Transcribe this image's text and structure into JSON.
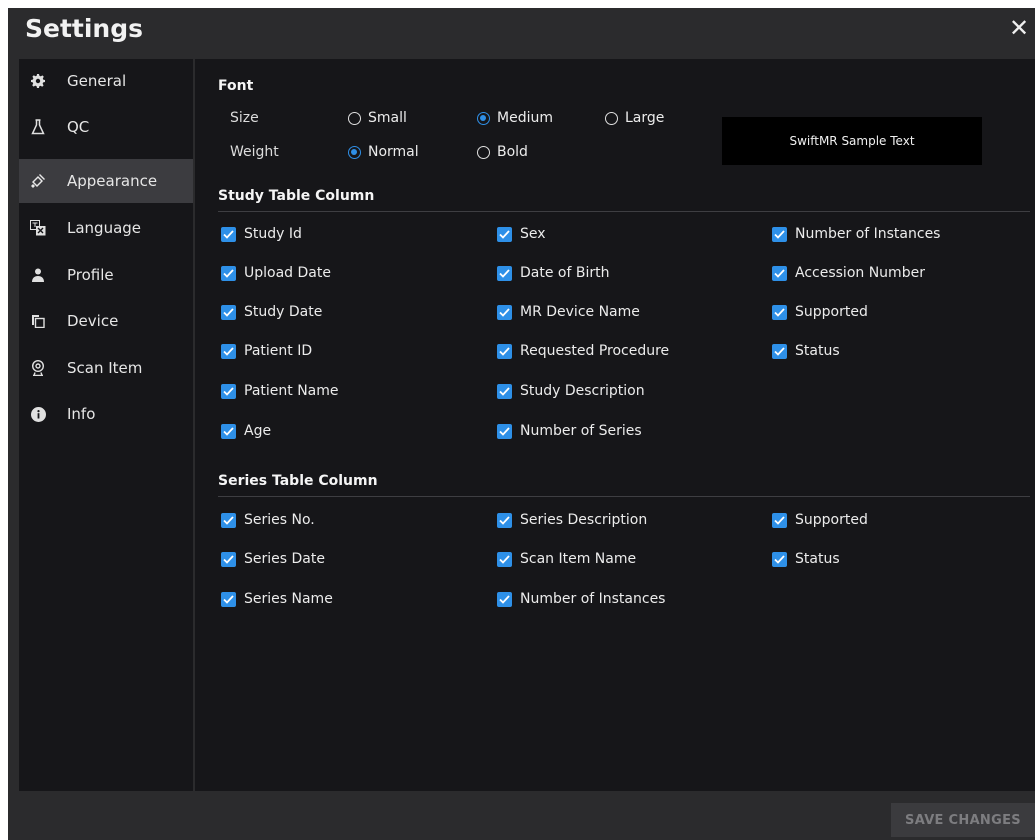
{
  "window": {
    "title": "Settings",
    "close_label": "✕"
  },
  "sidebar": {
    "items": [
      {
        "label": "General",
        "icon": "gear-icon"
      },
      {
        "label": "QC",
        "icon": "flask-icon"
      },
      {
        "label": "Appearance",
        "icon": "paint-brush-icon",
        "active": true
      },
      {
        "label": "Language",
        "icon": "translate-icon"
      },
      {
        "label": "Profile",
        "icon": "user-icon"
      },
      {
        "label": "Device",
        "icon": "copy-icon"
      },
      {
        "label": "Scan Item",
        "icon": "webcam-icon"
      },
      {
        "label": "Info",
        "icon": "info-icon"
      }
    ]
  },
  "font": {
    "section_title": "Font",
    "size_label": "Size",
    "size_options": [
      "Small",
      "Medium",
      "Large"
    ],
    "size_selected": "Medium",
    "weight_label": "Weight",
    "weight_options": [
      "Normal",
      "Bold"
    ],
    "weight_selected": "Normal",
    "sample_text": "SwiftMR Sample Text"
  },
  "study_table": {
    "section_title": "Study Table Column",
    "columns": [
      [
        "Study Id",
        "Upload Date",
        "Study Date",
        "Patient ID",
        "Patient Name",
        "Age"
      ],
      [
        "Sex",
        "Date of Birth",
        "MR Device Name",
        "Requested Procedure",
        "Study Description",
        "Number of Series"
      ],
      [
        "Number of Instances",
        "Accession Number",
        "Supported",
        "Status"
      ]
    ]
  },
  "series_table": {
    "section_title": "Series Table Column",
    "columns": [
      [
        "Series No.",
        "Series Date",
        "Series Name"
      ],
      [
        "Series Description",
        "Scan Item Name",
        "Number of Instances"
      ],
      [
        "Supported",
        "Status"
      ]
    ]
  },
  "footer": {
    "save_label": "SAVE CHANGES"
  },
  "colors": {
    "accent": "#2e90e8",
    "panel": "#161619",
    "frame": "#2b2b2d"
  }
}
